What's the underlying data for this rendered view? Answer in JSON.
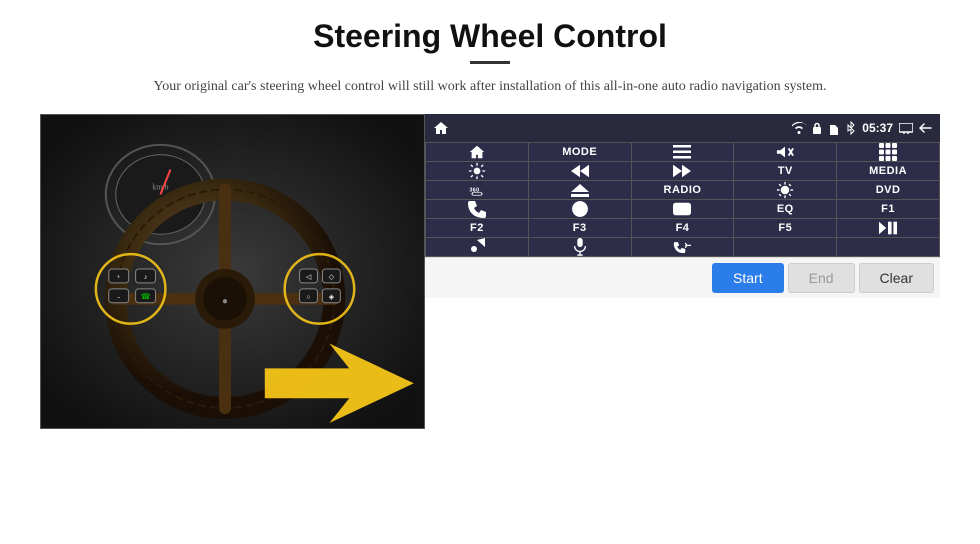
{
  "page": {
    "title": "Steering Wheel Control",
    "subtitle": "Your original car's steering wheel control will still work after installation of this all-in-one auto radio navigation system."
  },
  "statusBar": {
    "time": "05:37",
    "icons": [
      "wifi",
      "lock",
      "sim",
      "bluetooth",
      "screen",
      "back"
    ]
  },
  "buttons": [
    {
      "id": "r1c1",
      "type": "icon",
      "icon": "home"
    },
    {
      "id": "r1c2",
      "type": "text",
      "label": "MODE"
    },
    {
      "id": "r1c3",
      "type": "icon",
      "icon": "list"
    },
    {
      "id": "r1c4",
      "type": "icon",
      "icon": "mute"
    },
    {
      "id": "r1c5",
      "type": "icon",
      "icon": "grid"
    },
    {
      "id": "r2c1",
      "type": "icon",
      "icon": "settings-circle"
    },
    {
      "id": "r2c2",
      "type": "icon",
      "icon": "rewind"
    },
    {
      "id": "r2c3",
      "type": "icon",
      "icon": "fast-forward"
    },
    {
      "id": "r2c4",
      "type": "text",
      "label": "TV"
    },
    {
      "id": "r2c5",
      "type": "text",
      "label": "MEDIA"
    },
    {
      "id": "r3c1",
      "type": "icon",
      "icon": "360-car"
    },
    {
      "id": "r3c2",
      "type": "icon",
      "icon": "eject"
    },
    {
      "id": "r3c3",
      "type": "text",
      "label": "RADIO"
    },
    {
      "id": "r3c4",
      "type": "icon",
      "icon": "brightness"
    },
    {
      "id": "r3c5",
      "type": "text",
      "label": "DVD"
    },
    {
      "id": "r4c1",
      "type": "icon",
      "icon": "phone"
    },
    {
      "id": "r4c2",
      "type": "icon",
      "icon": "globe"
    },
    {
      "id": "r4c3",
      "type": "icon",
      "icon": "rectangle"
    },
    {
      "id": "r4c4",
      "type": "text",
      "label": "EQ"
    },
    {
      "id": "r4c5",
      "type": "text",
      "label": "F1"
    },
    {
      "id": "r5c1",
      "type": "text",
      "label": "F2"
    },
    {
      "id": "r5c2",
      "type": "text",
      "label": "F3"
    },
    {
      "id": "r5c3",
      "type": "text",
      "label": "F4"
    },
    {
      "id": "r5c4",
      "type": "text",
      "label": "F5"
    },
    {
      "id": "r5c5",
      "type": "icon",
      "icon": "play-pause"
    },
    {
      "id": "r6c1",
      "type": "icon",
      "icon": "music"
    },
    {
      "id": "r6c2",
      "type": "icon",
      "icon": "mic"
    },
    {
      "id": "r6c3",
      "type": "icon",
      "icon": "phone-call"
    },
    {
      "id": "r6c4",
      "type": "empty",
      "label": ""
    },
    {
      "id": "r6c5",
      "type": "empty",
      "label": ""
    }
  ],
  "actionButtons": {
    "start": "Start",
    "end": "End",
    "clear": "Clear"
  }
}
